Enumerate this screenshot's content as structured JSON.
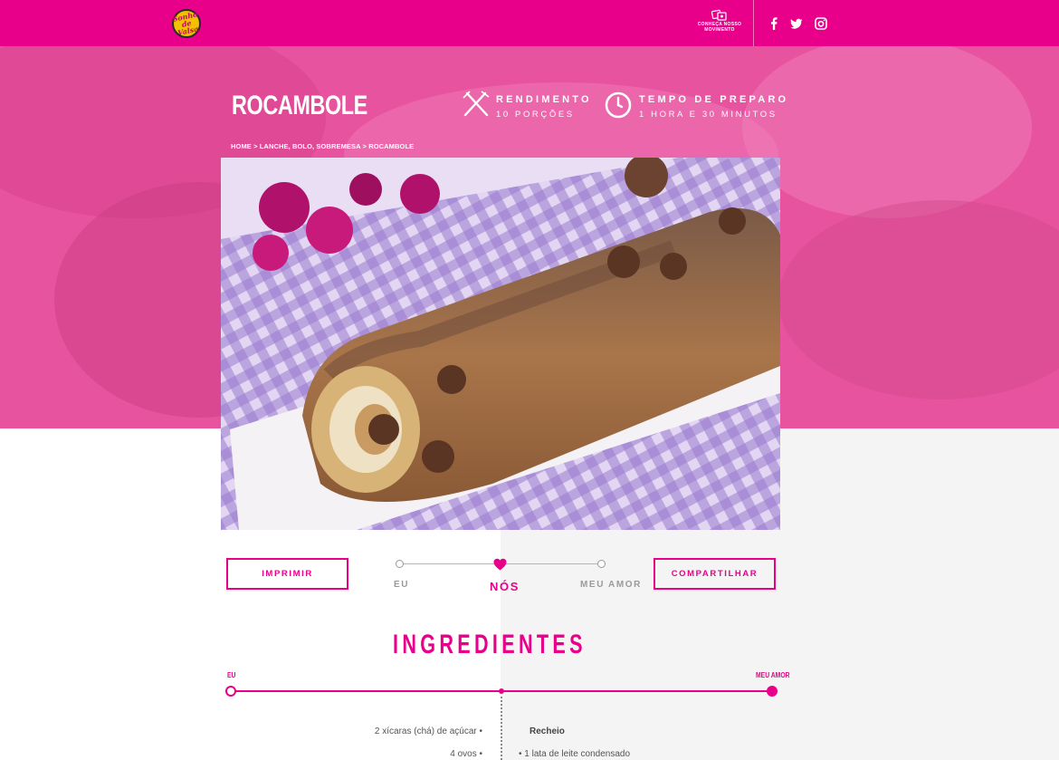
{
  "header": {
    "logo_text": "Sonho de Valsa",
    "movement_label": "Conheça nosso movimento",
    "movement_icon": "photos-icon",
    "social": [
      "facebook-icon",
      "twitter-icon",
      "instagram-icon"
    ],
    "brand_color": "#e9008a"
  },
  "recipe": {
    "title": "ROCAMBOLE",
    "yield_label": "RENDIMENTO",
    "yield_value": "10 PORÇÕES",
    "time_label": "TEMPO DE PREPARO",
    "time_value": "1 HORA E 30 MINUTOS",
    "breadcrumb": "HOME > LANCHE, BOLO, SOBREMESA > ROCAMBOLE"
  },
  "actions": {
    "print_label": "IMPRIMIR",
    "share_label": "COMPARTILHAR"
  },
  "portion_selector": {
    "options": [
      "EU",
      "NÓS",
      "MEU AMOR"
    ],
    "selected": "NÓS"
  },
  "ingredients": {
    "title": "INGREDIENTES",
    "scale_start": "EU",
    "scale_end": "MEU AMOR",
    "left_items": [
      "2 xícaras (chá) de açúcar",
      "4 ovos"
    ],
    "right_heading": "Recheio",
    "right_items": [
      "1 lata de leite condensado"
    ]
  }
}
